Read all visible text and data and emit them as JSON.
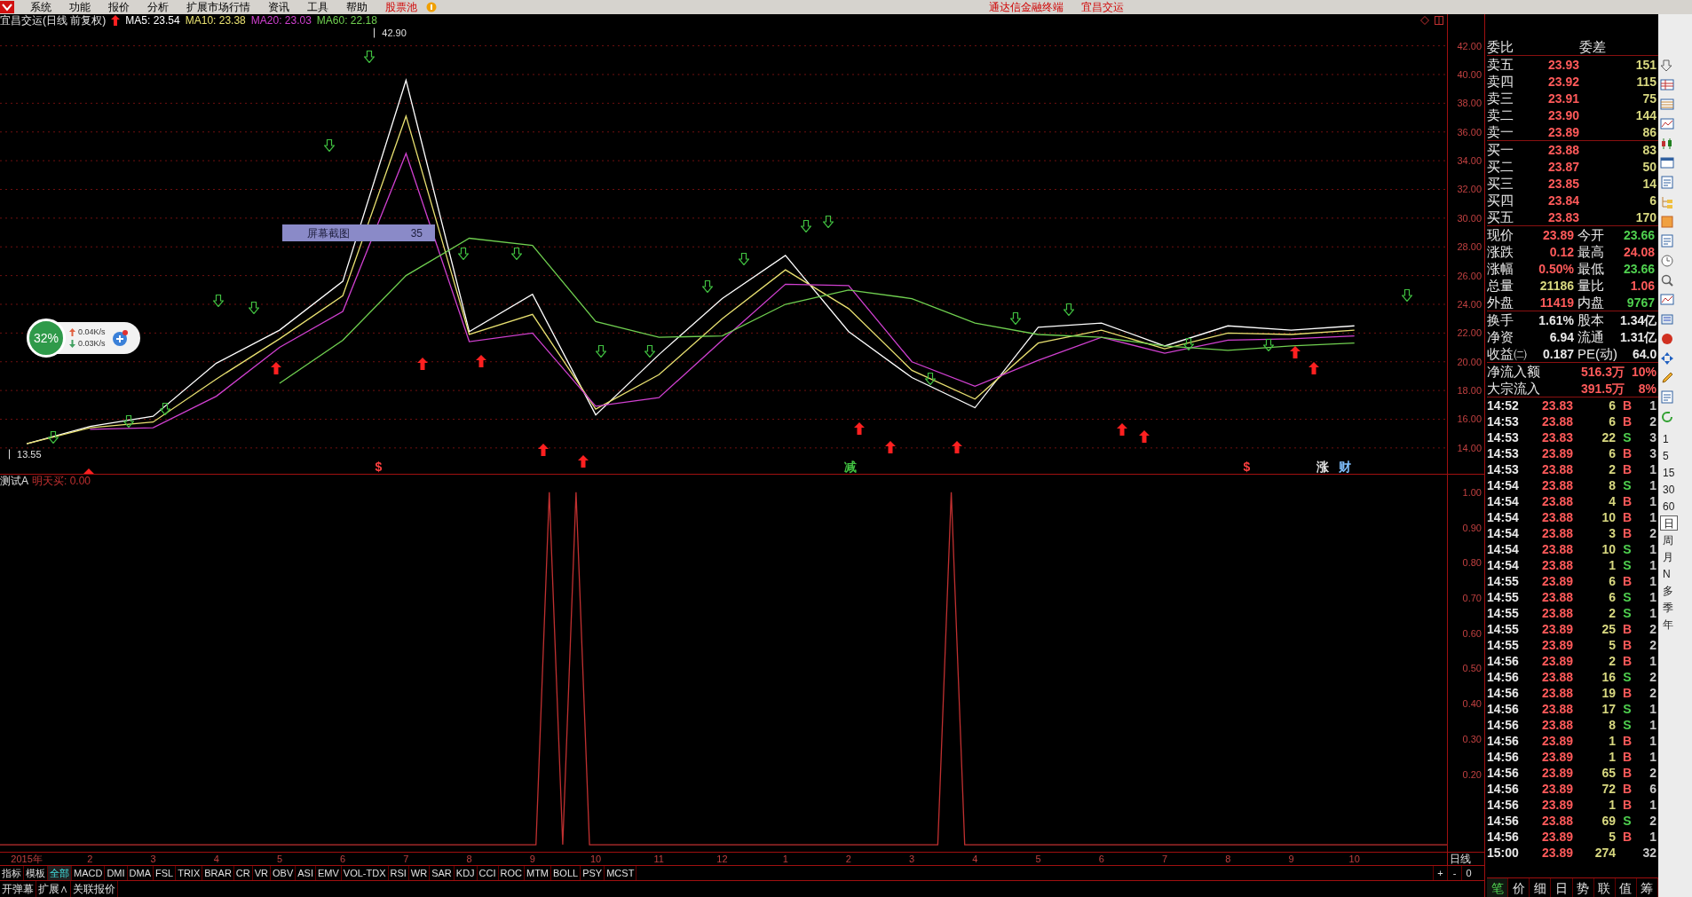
{
  "menubar": {
    "items": [
      {
        "label": "系统",
        "highlight": false
      },
      {
        "label": "功能",
        "highlight": false
      },
      {
        "label": "报价",
        "highlight": false
      },
      {
        "label": "分析",
        "highlight": false
      },
      {
        "label": "扩展市场行情",
        "highlight": false
      },
      {
        "label": "资讯",
        "highlight": false
      },
      {
        "label": "工具",
        "highlight": false
      },
      {
        "label": "帮助",
        "highlight": false
      },
      {
        "label": "股票池",
        "highlight": true
      }
    ],
    "title": [
      "通达信金融终端",
      "宜昌交运"
    ]
  },
  "price_chart": {
    "title": "宜昌交运(日线 前复权)",
    "legend": [
      {
        "reading": ": 23.54"
      },
      {
        "reading": ": 23.38"
      },
      {
        "reading": ": 23.03"
      },
      {
        "reading": ": 22.18"
      }
    ],
    "chart_data": {
      "type": "line",
      "categories": [
        null,
        null,
        null,
        null,
        null,
        null,
        null,
        null,
        null,
        null,
        null,
        null,
        null,
        null,
        null,
        null,
        null,
        null,
        null,
        null,
        null,
        null
      ],
      "series": [
        {
          "name": "MA5",
          "color": "#ffffff",
          "values": [
            14.3,
            15.5,
            16.2,
            19.9,
            22.2,
            25.6,
            39.6,
            22.1,
            24.7,
            16.3,
            20.5,
            24.4,
            27.4,
            22.1,
            18.9,
            16.8,
            22.4,
            22.7,
            21.1,
            22.5,
            22.2,
            22.5
          ]
        },
        {
          "name": "MA10",
          "color": "#e8e070",
          "values": [
            14.3,
            15.4,
            15.8,
            18.8,
            21.6,
            24.6,
            37.1,
            21.9,
            23.3,
            16.7,
            19.1,
            23.0,
            26.4,
            23.7,
            19.4,
            17.4,
            21.3,
            22.2,
            20.9,
            22.0,
            21.9,
            22.2
          ]
        },
        {
          "name": "MA20",
          "color": "#d040d0",
          "values": [
            null,
            15.3,
            15.4,
            17.6,
            21.0,
            23.5,
            34.5,
            21.4,
            22.0,
            16.9,
            17.5,
            21.5,
            25.4,
            25.3,
            20.0,
            18.3,
            20.1,
            21.7,
            20.6,
            21.5,
            21.6,
            21.8
          ]
        },
        {
          "name": "MA60",
          "color": "#70d050",
          "values": [
            null,
            null,
            null,
            null,
            18.5,
            21.5,
            26.0,
            28.6,
            28.1,
            22.8,
            21.7,
            21.8,
            24.0,
            25.0,
            24.4,
            22.7,
            21.9,
            21.7,
            21.1,
            20.8,
            21.1,
            21.3
          ]
        }
      ],
      "ylim": [
        12.2,
        44.2
      ],
      "yticks": [
        {
          "value": 14,
          "label": "14.00"
        },
        {
          "value": 16,
          "label": "16.00"
        },
        {
          "value": 18,
          "label": "18.00"
        },
        {
          "value": 20,
          "label": "20.00"
        },
        {
          "value": 22,
          "label": "22.00"
        },
        {
          "value": 24,
          "label": "24.00"
        },
        {
          "value": 26,
          "label": "26.00"
        },
        {
          "value": 28,
          "label": "28.00"
        },
        {
          "value": 30,
          "label": "30.00"
        },
        {
          "value": 32,
          "label": "32.00"
        },
        {
          "value": 34,
          "label": "34.00"
        },
        {
          "value": 36,
          "label": "36.00"
        },
        {
          "value": 38,
          "label": "38.00"
        },
        {
          "value": 40,
          "label": "40.00"
        },
        {
          "value": 42,
          "label": "42.00"
        }
      ],
      "grid": true
    },
    "extreme_labels": [
      "42.90",
      "13.55"
    ],
    "signals": [
      {
        "kind": "buy"
      },
      {
        "kind": "buy"
      },
      {
        "kind": "buy"
      },
      {
        "kind": "buy"
      },
      {
        "kind": "buy"
      },
      {
        "kind": "buy"
      },
      {
        "kind": "buy"
      },
      {
        "kind": "buy"
      },
      {
        "kind": "buy"
      },
      {
        "kind": "buy"
      },
      {
        "kind": "buy"
      },
      {
        "kind": "buy"
      },
      {
        "kind": "buy"
      },
      {
        "kind": "sell"
      },
      {
        "kind": "sell"
      },
      {
        "kind": "sell"
      },
      {
        "kind": "sell"
      },
      {
        "kind": "sell"
      },
      {
        "kind": "sell"
      },
      {
        "kind": "sell"
      },
      {
        "kind": "sell"
      },
      {
        "kind": "sell"
      },
      {
        "kind": "sell"
      },
      {
        "kind": "sell"
      },
      {
        "kind": "sell"
      },
      {
        "kind": "sell"
      },
      {
        "kind": "sell"
      },
      {
        "kind": "sell"
      },
      {
        "kind": "sell"
      },
      {
        "kind": "sell"
      },
      {
        "kind": "sell"
      },
      {
        "kind": "sell"
      },
      {
        "kind": "sell"
      },
      {
        "kind": "sell"
      }
    ],
    "event_marks": [
      {
        "text": "$",
        "color": "#ff4040"
      },
      {
        "text": "减",
        "color": "#40c040"
      },
      {
        "text": "$",
        "color": "#ff4040"
      },
      {
        "text": "涨",
        "color": "#e0e0e0"
      },
      {
        "text": "财",
        "color": "#80c0ff"
      }
    ]
  },
  "screenshot_tooltip": {
    "label": "屏幕截图",
    "value": "35"
  },
  "network_widget": {
    "percent": "32%",
    "upload": "0.04K/s",
    "download": "0.03K/s"
  },
  "indicator_chart": {
    "name": "测试A",
    "reading": ": 0.00",
    "chart_data": {
      "type": "line",
      "categories": [
        null,
        null,
        null,
        null,
        null,
        null,
        null,
        null,
        null,
        null,
        null,
        null,
        null,
        null,
        null,
        null,
        null,
        null,
        null,
        null,
        null,
        null,
        null,
        null,
        null,
        null,
        null,
        null,
        null,
        null,
        null,
        null,
        null,
        null,
        null,
        null,
        null,
        null,
        null,
        null,
        null,
        null,
        null,
        null,
        null,
        null,
        null,
        null,
        null,
        null,
        null,
        null,
        null,
        null,
        null,
        null,
        null,
        null,
        null,
        null,
        null,
        null,
        null,
        null,
        null,
        null,
        null,
        null,
        null,
        null,
        null,
        null,
        null,
        null,
        null,
        null,
        null,
        null,
        null,
        null,
        null,
        null,
        null,
        null,
        null,
        null,
        null,
        null,
        null,
        null,
        null,
        null,
        null,
        null,
        null,
        null,
        null,
        null,
        null,
        null,
        null,
        null,
        null,
        null,
        null,
        null,
        null,
        null,
        null
      ],
      "series": [
        {
          "name": "明天买",
          "color": "#c03030",
          "values": [
            0,
            0,
            0,
            0,
            0,
            0,
            0,
            0,
            0,
            0,
            0,
            0,
            0,
            0,
            0,
            0,
            0,
            0,
            0,
            0,
            0,
            0,
            0,
            0,
            0,
            0,
            0,
            0,
            0,
            0,
            0,
            0,
            0,
            0,
            0,
            0,
            0,
            0,
            0,
            0,
            0,
            1,
            0,
            1,
            0,
            0,
            0,
            0,
            0,
            0,
            0,
            0,
            0,
            0,
            0,
            0,
            0,
            0,
            0,
            0,
            0,
            0,
            0,
            0,
            0,
            0,
            0,
            0,
            0,
            0,
            0,
            1,
            0,
            0,
            0,
            0,
            0,
            0,
            0,
            0,
            0,
            0,
            0,
            0,
            0,
            0,
            0,
            0,
            0,
            0,
            0,
            0,
            0,
            0,
            0,
            0,
            0,
            0,
            0,
            0,
            0,
            0,
            0,
            0,
            0,
            0,
            0,
            0,
            0
          ]
        }
      ],
      "ylim": [
        -0.02,
        1.05
      ],
      "yticks": [
        {
          "value": 0.2,
          "label": "0.20"
        },
        {
          "value": 0.3,
          "label": "0.30"
        },
        {
          "value": 0.4,
          "label": "0.40"
        },
        {
          "value": 0.5,
          "label": "0.50"
        },
        {
          "value": 0.6,
          "label": "0.60"
        },
        {
          "value": 0.7,
          "label": "0.70"
        },
        {
          "value": 0.8,
          "label": "0.80"
        },
        {
          "value": 0.9,
          "label": "0.90"
        },
        {
          "value": 1.0,
          "label": "1.00"
        }
      ]
    }
  },
  "date_axis": {
    "labels": [
      "2015年",
      "2",
      "3",
      "4",
      "5",
      "6",
      "7",
      "8",
      "9",
      "10",
      "11",
      "12",
      "1",
      "2",
      "3",
      "4",
      "5",
      "6",
      "7",
      "8",
      "9",
      "10"
    ],
    "period": "日线"
  },
  "indicator_tabs": [
    {
      "label": "指标",
      "selected": false
    },
    {
      "label": "模板",
      "selected": false
    },
    {
      "label": "全部",
      "selected": true
    },
    {
      "label": "MACD",
      "selected": false
    },
    {
      "label": "DMI",
      "selected": false
    },
    {
      "label": "DMA",
      "selected": false
    },
    {
      "label": "FSL",
      "selected": false
    },
    {
      "label": "TRIX",
      "selected": false
    },
    {
      "label": "BRAR",
      "selected": false
    },
    {
      "label": "CR",
      "selected": false
    },
    {
      "label": "VR",
      "selected": false
    },
    {
      "label": "OBV",
      "selected": false
    },
    {
      "label": "ASI",
      "selected": false
    },
    {
      "label": "EMV",
      "selected": false
    },
    {
      "label": "VOL-TDX",
      "selected": false
    },
    {
      "label": "RSI",
      "selected": false
    },
    {
      "label": "WR",
      "selected": false
    },
    {
      "label": "SAR",
      "selected": false
    },
    {
      "label": "KDJ",
      "selected": false
    },
    {
      "label": "CCI",
      "selected": false
    },
    {
      "label": "ROC",
      "selected": false
    },
    {
      "label": "MTM",
      "selected": false
    },
    {
      "label": "BOLL",
      "selected": false
    },
    {
      "label": "PSY",
      "selected": false
    },
    {
      "label": "MCST",
      "selected": false
    }
  ],
  "zoom_buttons": [
    "+",
    "-",
    "0"
  ],
  "bottom_bar": [
    "开弹幕",
    "扩展∧",
    "关联报价"
  ],
  "order_book": {
    "header": [
      "委比",
      "委差"
    ],
    "asks": [
      {
        "label": "卖五",
        "price": "23.93",
        "volume": "151"
      },
      {
        "label": "卖四",
        "price": "23.92",
        "volume": "115"
      },
      {
        "label": "卖三",
        "price": "23.91",
        "volume": "75"
      },
      {
        "label": "卖二",
        "price": "23.90",
        "volume": "144"
      },
      {
        "label": "卖一",
        "price": "23.89",
        "volume": "86"
      }
    ],
    "bids": [
      {
        "label": "买一",
        "price": "23.88",
        "volume": "83"
      },
      {
        "label": "买二",
        "price": "23.87",
        "volume": "50"
      },
      {
        "label": "买三",
        "price": "23.85",
        "volume": "14"
      },
      {
        "label": "买四",
        "price": "23.84",
        "volume": "6"
      },
      {
        "label": "买五",
        "price": "23.83",
        "volume": "170"
      }
    ]
  },
  "quote_stats": [
    {
      "label": "现价",
      "value": "23.89",
      "color": "#ff5a5a"
    },
    {
      "label": "今开",
      "value": "23.66",
      "color": "#4fd04f"
    },
    {
      "label": "涨跌",
      "value": "0.12",
      "color": "#ff5a5a"
    },
    {
      "label": "最高",
      "value": "24.08",
      "color": "#ff5a5a"
    },
    {
      "label": "涨幅",
      "value": "0.50%",
      "color": "#ff5a5a"
    },
    {
      "label": "最低",
      "value": "23.66",
      "color": "#4fd04f"
    },
    {
      "label": "总量",
      "value": "21186",
      "color": "#d8d880"
    },
    {
      "label": "量比",
      "value": "1.06",
      "color": "#ff5a5a"
    },
    {
      "label": "外盘",
      "value": "11419",
      "color": "#ff5a5a"
    },
    {
      "label": "内盘",
      "value": "9767",
      "color": "#4fd04f"
    }
  ],
  "share_stats": [
    {
      "label": "换手",
      "value": "1.61%"
    },
    {
      "label": "股本",
      "value": "1.34亿"
    },
    {
      "label": "净资",
      "value": "6.94"
    },
    {
      "label": "流通",
      "value": "1.31亿"
    },
    {
      "label": "收益㈡",
      "value": "0.187"
    },
    {
      "label": "PE(动)",
      "value": "64.0"
    }
  ],
  "flows": [
    {
      "label": "净流入额",
      "amount": "516.3万",
      "ratio": "10%"
    },
    {
      "label": "大宗流入",
      "amount": "391.5万",
      "ratio": "8%"
    }
  ],
  "trades": [
    {
      "time": "14:52",
      "price": "23.83",
      "volume": "6",
      "kind": "buy",
      "side": "B",
      "count": "1"
    },
    {
      "time": "14:53",
      "price": "23.88",
      "volume": "6",
      "kind": "buy",
      "side": "B",
      "count": "2"
    },
    {
      "time": "14:53",
      "price": "23.83",
      "volume": "22",
      "kind": "sell",
      "side": "S",
      "count": "3"
    },
    {
      "time": "14:53",
      "price": "23.89",
      "volume": "6",
      "kind": "buy",
      "side": "B",
      "count": "3"
    },
    {
      "time": "14:53",
      "price": "23.88",
      "volume": "2",
      "kind": "buy",
      "side": "B",
      "count": "1"
    },
    {
      "time": "14:54",
      "price": "23.88",
      "volume": "8",
      "kind": "sell",
      "side": "S",
      "count": "1"
    },
    {
      "time": "14:54",
      "price": "23.88",
      "volume": "4",
      "kind": "buy",
      "side": "B",
      "count": "1"
    },
    {
      "time": "14:54",
      "price": "23.88",
      "volume": "10",
      "kind": "buy",
      "side": "B",
      "count": "1"
    },
    {
      "time": "14:54",
      "price": "23.88",
      "volume": "3",
      "kind": "buy",
      "side": "B",
      "count": "2"
    },
    {
      "time": "14:54",
      "price": "23.88",
      "volume": "10",
      "kind": "sell",
      "side": "S",
      "count": "1"
    },
    {
      "time": "14:54",
      "price": "23.88",
      "volume": "1",
      "kind": "sell",
      "side": "S",
      "count": "1"
    },
    {
      "time": "14:55",
      "price": "23.89",
      "volume": "6",
      "kind": "buy",
      "side": "B",
      "count": "1"
    },
    {
      "time": "14:55",
      "price": "23.88",
      "volume": "6",
      "kind": "sell",
      "side": "S",
      "count": "1"
    },
    {
      "time": "14:55",
      "price": "23.88",
      "volume": "2",
      "kind": "sell",
      "side": "S",
      "count": "1"
    },
    {
      "time": "14:55",
      "price": "23.89",
      "volume": "25",
      "kind": "buy",
      "side": "B",
      "count": "2"
    },
    {
      "time": "14:55",
      "price": "23.89",
      "volume": "5",
      "kind": "buy",
      "side": "B",
      "count": "2"
    },
    {
      "time": "14:56",
      "price": "23.89",
      "volume": "2",
      "kind": "buy",
      "side": "B",
      "count": "1"
    },
    {
      "time": "14:56",
      "price": "23.88",
      "volume": "16",
      "kind": "sell",
      "side": "S",
      "count": "2"
    },
    {
      "time": "14:56",
      "price": "23.88",
      "volume": "19",
      "kind": "buy",
      "side": "B",
      "count": "2"
    },
    {
      "time": "14:56",
      "price": "23.88",
      "volume": "17",
      "kind": "sell",
      "side": "S",
      "count": "1"
    },
    {
      "time": "14:56",
      "price": "23.88",
      "volume": "8",
      "kind": "sell",
      "side": "S",
      "count": "1"
    },
    {
      "time": "14:56",
      "price": "23.89",
      "volume": "1",
      "kind": "buy",
      "side": "B",
      "count": "1"
    },
    {
      "time": "14:56",
      "price": "23.89",
      "volume": "1",
      "kind": "buy",
      "side": "B",
      "count": "1"
    },
    {
      "time": "14:56",
      "price": "23.89",
      "volume": "65",
      "kind": "buy",
      "side": "B",
      "count": "2"
    },
    {
      "time": "14:56",
      "price": "23.89",
      "volume": "72",
      "kind": "buy",
      "side": "B",
      "count": "6"
    },
    {
      "time": "14:56",
      "price": "23.89",
      "volume": "1",
      "kind": "buy",
      "side": "B",
      "count": "1"
    },
    {
      "time": "14:56",
      "price": "23.88",
      "volume": "69",
      "kind": "sell",
      "side": "S",
      "count": "2"
    },
    {
      "time": "14:56",
      "price": "23.89",
      "volume": "5",
      "kind": "buy",
      "side": "B",
      "count": "1"
    },
    {
      "time": "15:00",
      "price": "23.89",
      "volume": "274",
      "kind": "none",
      "count": "32"
    }
  ],
  "detail_tabs": [
    {
      "label": "笔",
      "selected": true
    },
    {
      "label": "价",
      "selected": false
    },
    {
      "label": "细",
      "selected": false
    },
    {
      "label": "日",
      "selected": false
    },
    {
      "label": "势",
      "selected": false
    },
    {
      "label": "联",
      "selected": false
    },
    {
      "label": "值",
      "selected": false
    },
    {
      "label": "筹",
      "selected": false
    }
  ],
  "periods": [
    {
      "label": "1",
      "selected": false
    },
    {
      "label": "5",
      "selected": false
    },
    {
      "label": "15",
      "selected": false
    },
    {
      "label": "30",
      "selected": false
    },
    {
      "label": "60",
      "selected": false
    },
    {
      "label": "日",
      "selected": true
    },
    {
      "label": "周",
      "selected": false
    },
    {
      "label": "月",
      "selected": false
    },
    {
      "label": "N",
      "selected": false
    },
    {
      "label": "多",
      "selected": false
    },
    {
      "label": "季",
      "selected": false
    },
    {
      "label": "年",
      "selected": false
    }
  ]
}
